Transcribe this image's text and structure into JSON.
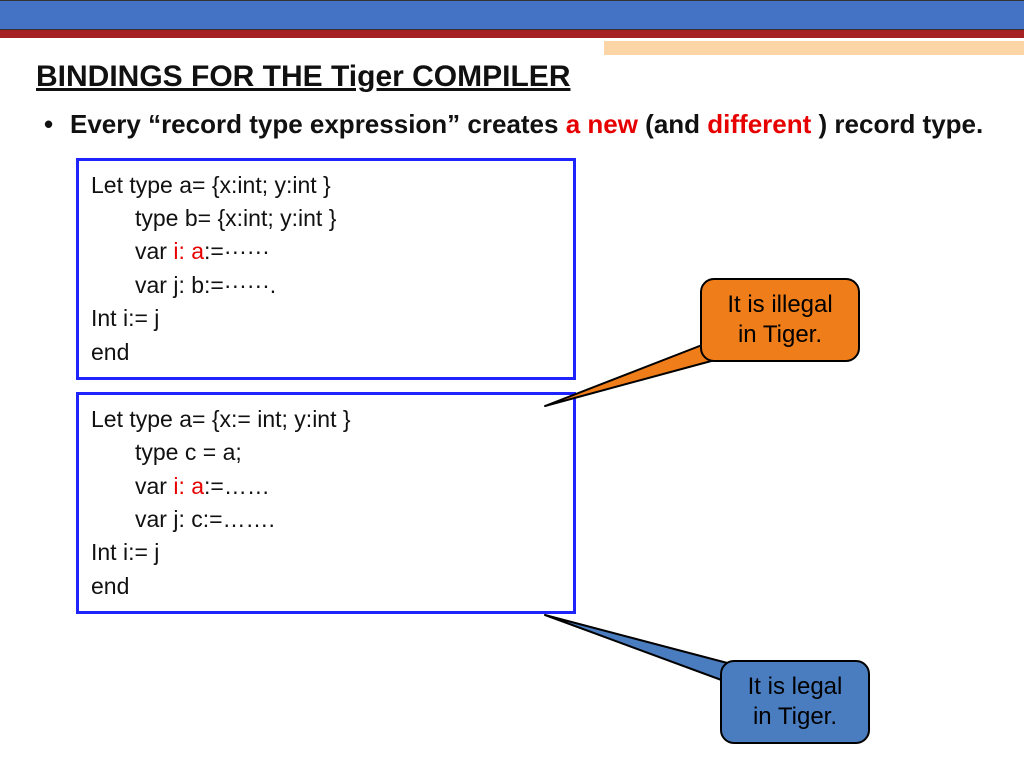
{
  "title": "BINDINGS FOR THE Tiger COMPILER",
  "bullet": {
    "p1": "Every “record type expression” creates ",
    "p2": "a new",
    "p3": " (and ",
    "p4": "different",
    "p5": " ) record type."
  },
  "code1": {
    "l1": "Let type a= {x:int; y:int }",
    "l2": "type b= {x:int; y:int }",
    "l3a": "var ",
    "l3b": "i:  a",
    "l3c": ":=······",
    "l4": "var j:  b:=······.",
    "l5": "Int  i:= j",
    "l6": "end"
  },
  "code2": {
    "l1": "Let type a= {x:= int; y:int }",
    "l2": "type c = a;",
    "l3a": "var ",
    "l3b": "i:  a",
    "l3c": ":=……",
    "l4": "var j:  c:=…….",
    "l5": "Int  i:= j",
    "l6": "end"
  },
  "callout1": {
    "l1": "It is illegal",
    "l2": "in Tiger."
  },
  "callout2": {
    "l1": "It is legal",
    "l2": "in Tiger."
  }
}
